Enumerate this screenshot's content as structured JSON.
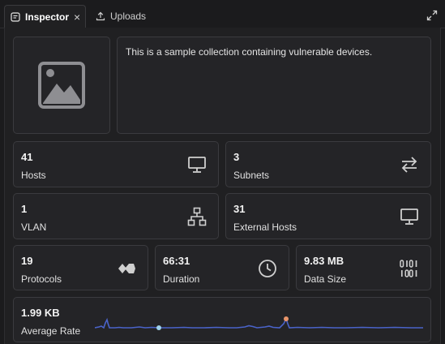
{
  "tabs": [
    {
      "label": "Inspector",
      "active": true,
      "icon": "inspector-icon"
    },
    {
      "label": "Uploads",
      "active": false,
      "icon": "upload-icon"
    }
  ],
  "tab_close": "×",
  "overview": {
    "thumbnail_icon": "image-placeholder-icon",
    "description": "This is a sample collection containing vulnerable devices."
  },
  "stats": {
    "hosts": {
      "value": "41",
      "label": "Hosts",
      "icon": "monitor-icon"
    },
    "subnets": {
      "value": "3",
      "label": "Subnets",
      "icon": "arrows-swap-icon"
    },
    "vlan": {
      "value": "1",
      "label": "VLAN",
      "icon": "network-tree-icon"
    },
    "external_hosts": {
      "value": "31",
      "label": "External Hosts",
      "icon": "monitor-icon"
    },
    "protocols": {
      "value": "19",
      "label": "Protocols",
      "icon": "protocols-icon"
    },
    "duration": {
      "value": "66:31",
      "label": "Duration",
      "icon": "clock-icon"
    },
    "data_size": {
      "value": "9.83 MB",
      "label": "Data Size",
      "icon": "binary-icon"
    },
    "average_rate": {
      "value": "1.99 KB",
      "label": "Average Rate"
    }
  },
  "colors": {
    "sparkline": "#4a63c9",
    "peak_marker": "#e8956a",
    "low_marker": "#9fd3ea"
  }
}
